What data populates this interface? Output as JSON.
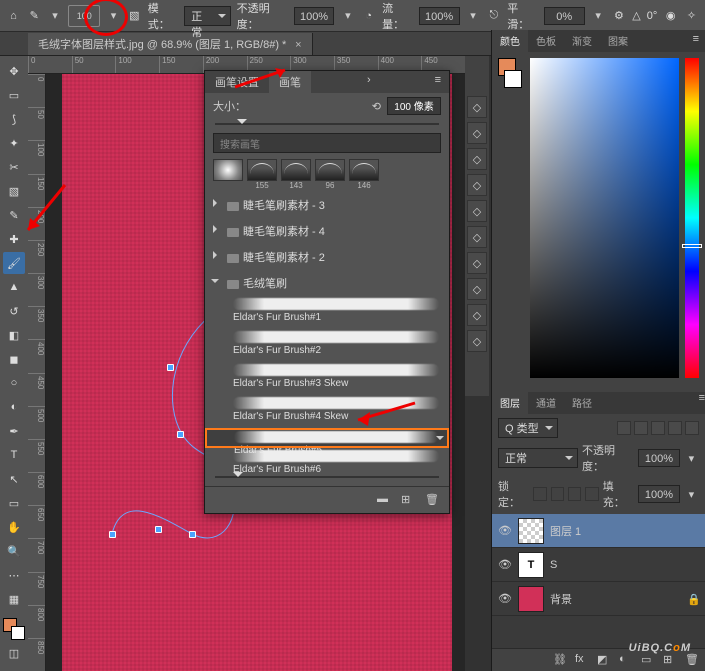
{
  "topbar": {
    "brush_size_top": "100",
    "mode_label": "模式：",
    "mode_value": "正常",
    "opacity_label": "不透明度：",
    "opacity_value": "100%",
    "flow_label": "流量：",
    "flow_value": "100%",
    "smooth_label": "平滑：",
    "smooth_value": "0%",
    "angle_icon": "△",
    "angle_value": "0°"
  },
  "document": {
    "tab_title": "毛绒字体图层样式.jpg @ 68.9% (图层 1, RGB/8#) *"
  },
  "ruler_h": [
    "0",
    "50",
    "100",
    "150",
    "200",
    "250",
    "300",
    "350",
    "400",
    "450"
  ],
  "ruler_v": [
    "0",
    "50",
    "100",
    "150",
    "200",
    "250",
    "300",
    "350",
    "400",
    "450",
    "500",
    "550",
    "600",
    "650",
    "700",
    "750",
    "800",
    "850"
  ],
  "tools": [
    {
      "name": "move-tool",
      "glyph": "✥"
    },
    {
      "name": "marquee-tool",
      "glyph": "▭"
    },
    {
      "name": "lasso-tool",
      "glyph": "⟆"
    },
    {
      "name": "magic-wand-tool",
      "glyph": "✦"
    },
    {
      "name": "crop-tool",
      "glyph": "✂"
    },
    {
      "name": "frame-tool",
      "glyph": "▧"
    },
    {
      "name": "eyedropper-tool",
      "glyph": "✎"
    },
    {
      "name": "healing-tool",
      "glyph": "✚"
    },
    {
      "name": "brush-tool",
      "glyph": "🖌",
      "active": true
    },
    {
      "name": "stamp-tool",
      "glyph": "▲"
    },
    {
      "name": "history-brush-tool",
      "glyph": "↺"
    },
    {
      "name": "eraser-tool",
      "glyph": "◧"
    },
    {
      "name": "gradient-tool",
      "glyph": "◼"
    },
    {
      "name": "blur-tool",
      "glyph": "○"
    },
    {
      "name": "dodge-tool",
      "glyph": "◐"
    },
    {
      "name": "pen-tool",
      "glyph": "✒"
    },
    {
      "name": "type-tool",
      "glyph": "T"
    },
    {
      "name": "path-select-tool",
      "glyph": "↖"
    },
    {
      "name": "shape-tool",
      "glyph": "▭"
    },
    {
      "name": "hand-tool",
      "glyph": "✋"
    },
    {
      "name": "zoom-tool",
      "glyph": "🔍"
    },
    {
      "name": "more-tool",
      "glyph": "⋯"
    },
    {
      "name": "edit-toolbar",
      "glyph": "▦"
    }
  ],
  "swatch": {
    "fg": "#e58a5a",
    "bg": "#ffffff"
  },
  "brush_panel": {
    "tabs": [
      "画笔设置",
      "画笔"
    ],
    "active_tab": 1,
    "size_label": "大小：",
    "size_value": "100 像素",
    "search_placeholder": "搜索画笔",
    "thumb_sizes": [
      "",
      "155",
      "143",
      "96",
      "146"
    ],
    "folders": [
      {
        "label": "睫毛笔刷素材 - 3",
        "open": false
      },
      {
        "label": "睫毛笔刷素材 - 4",
        "open": false
      },
      {
        "label": "睫毛笔刷素材 - 2",
        "open": false
      },
      {
        "label": "毛绒笔刷",
        "open": true
      }
    ],
    "brushes": [
      {
        "name": "Eldar's Fur Brush#1"
      },
      {
        "name": "Eldar's Fur Brush#2"
      },
      {
        "name": "Eldar's Fur Brush#3 Skew"
      },
      {
        "name": "Eldar's Fur Brush#4 Skew"
      },
      {
        "name": "Eldar's Fur Brush#5",
        "selected": true
      },
      {
        "name": "Eldar's Fur Brush#6"
      }
    ]
  },
  "side_panel_icons": [
    "brush-settings-icon",
    "brush-preset-icon",
    "character-icon",
    "paragraph-icon",
    "glyphs-icon",
    "properties-icon",
    "notes-icon",
    "clone-source-icon",
    "color-icon",
    "swatches-icon"
  ],
  "color_panel": {
    "tabs": [
      "颜色",
      "色板",
      "渐变",
      "图案"
    ],
    "active": 0,
    "fg": "#e58a5a"
  },
  "layers_panel": {
    "tabs": [
      "图层",
      "通道",
      "路径"
    ],
    "active": 0,
    "kind_label": "Q 类型",
    "blend_value": "正常",
    "opacity_label": "不透明度：",
    "opacity_value": "100%",
    "lock_label": "锁定：",
    "fill_label": "填充：",
    "fill_value": "100%",
    "layers": [
      {
        "name": "图层 1",
        "thumb": "checker",
        "visible": true,
        "active": true
      },
      {
        "name": "S",
        "thumb": "text",
        "visible": true
      },
      {
        "name": "背景",
        "thumb": "bg",
        "visible": true,
        "locked": true
      }
    ]
  },
  "watermark": {
    "text": "UiBQ.C",
    "o": "o",
    "m": "M"
  }
}
